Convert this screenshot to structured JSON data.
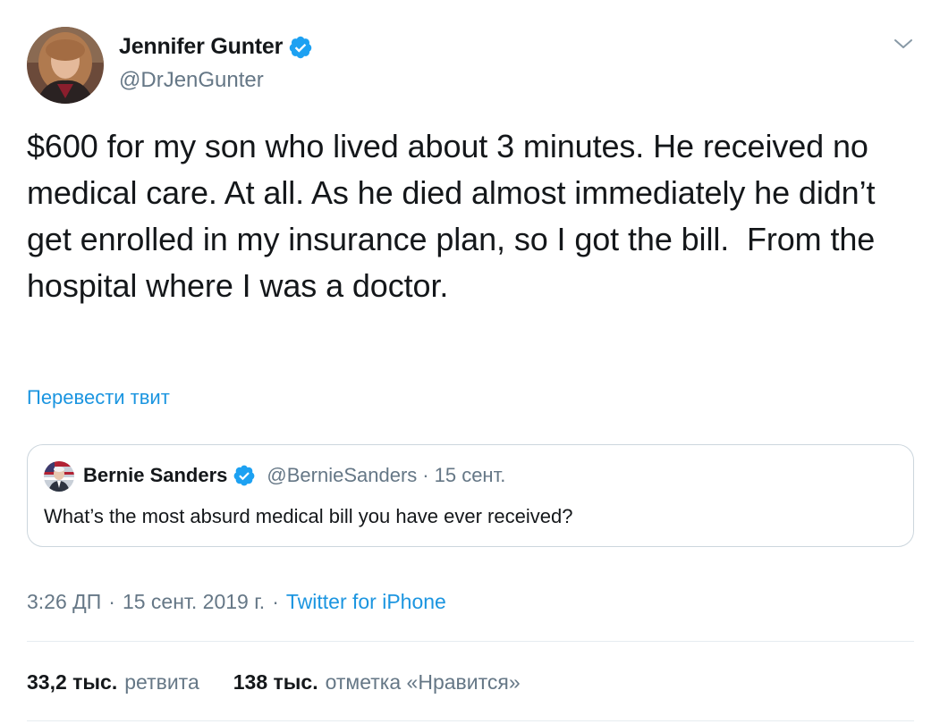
{
  "colors": {
    "text": "#14171a",
    "secondary": "#657786",
    "link": "#1b95e0",
    "verified": "#1da1f2",
    "border": "#ccd6dd",
    "divider": "#e6ecf0"
  },
  "author": {
    "name": "Jennifer Gunter",
    "handle": "@DrJenGunter",
    "verified_icon": "verified-badge-icon",
    "avatar_icon": "profile-photo"
  },
  "menu_icon": "chevron-down-icon",
  "tweet": {
    "text": "$600 for my son who lived about 3 minutes. He received no medical care. At all. As he died almost immediately he didn’t get enrolled in my insurance plan, so I got the bill.  From the hospital where I was a doctor.",
    "translate_label": "Перевести твит"
  },
  "quote": {
    "name": "Bernie Sanders",
    "handle": "@BernieSanders",
    "separator": "·",
    "date": "15 сент.",
    "text": "What’s the most absurd medical bill you have ever received?"
  },
  "meta": {
    "time": "3:26 ДП",
    "separator": "·",
    "date": "15 сент. 2019 г.",
    "source": "Twitter for iPhone"
  },
  "stats": {
    "retweets_count": "33,2 тыс.",
    "retweets_label": "ретвита",
    "likes_count": "138 тыс.",
    "likes_label": "отметка «Нравится»"
  }
}
